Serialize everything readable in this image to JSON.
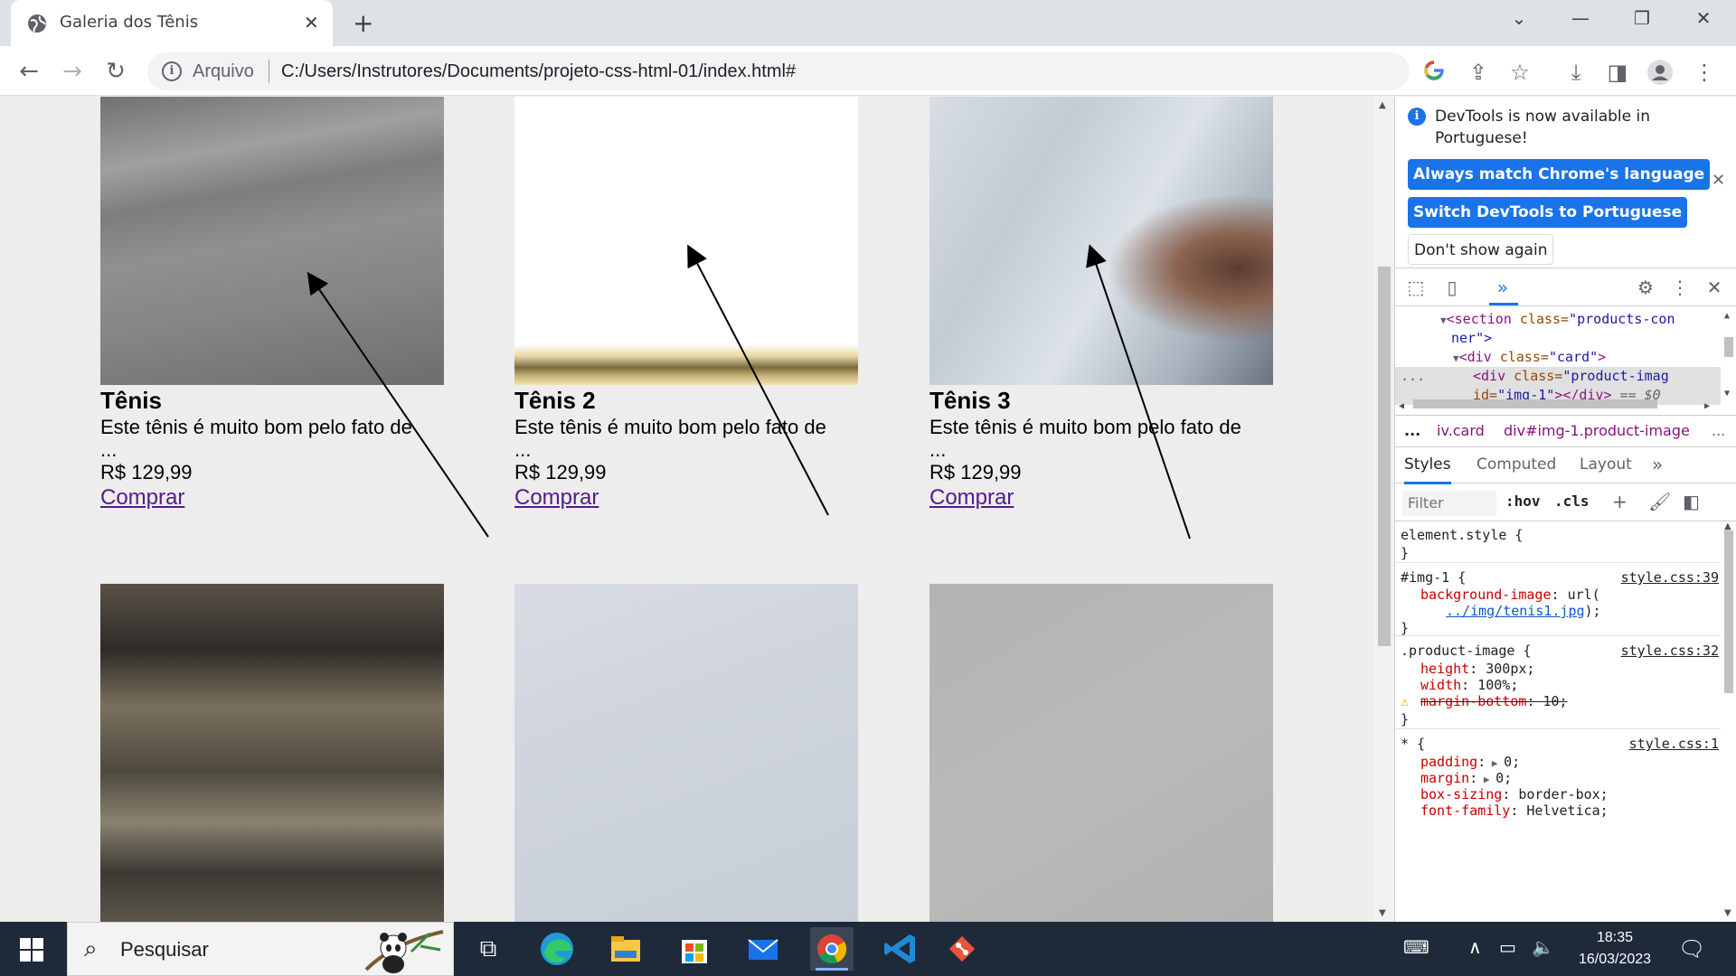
{
  "browser": {
    "tab_title": "Galeria dos Tênis",
    "omnibox_prefix": "Arquivo",
    "url": "C:/Users/Instrutores/Documents/projeto-css-html-01/index.html#"
  },
  "page": {
    "cards": [
      {
        "title": "Tênis",
        "description": "Este tênis é muito bom pelo fato de",
        "ellipsis": "...",
        "price": "R$ 129,99",
        "link": "Comprar"
      },
      {
        "title": "Tênis 2",
        "description": "Este tênis é muito bom pelo fato de",
        "ellipsis": "...",
        "price": "R$ 129,99",
        "link": "Comprar"
      },
      {
        "title": "Tênis 3",
        "description": "Este tênis é muito bom pelo fato de",
        "ellipsis": "...",
        "price": "R$ 129,99",
        "link": "Comprar"
      }
    ]
  },
  "devtools": {
    "banner": {
      "message": "DevTools is now available in Portuguese!",
      "btn_match": "Always match Chrome's language",
      "btn_switch": "Switch DevTools to Portuguese",
      "btn_dont_show": "Don't show again"
    },
    "dom": {
      "line1_tag": "<section ",
      "line1_attr": "class=",
      "line1_val": "\"products-con",
      "line2": "ner\">",
      "line3_tag": "<div ",
      "line3_attr": "class=",
      "line3_val": "\"card\"",
      "line3_end": ">",
      "line4_tag": "<div ",
      "line4_attr": "class=",
      "line4_val": "\"product-imag",
      "line5_attr": "id=",
      "line5_val": "\"img-1\"",
      "line5_end": "></div>",
      "line5_eq": " == $0",
      "gutter": "..."
    },
    "breadcrumbs": {
      "more": "...",
      "item1": "iv.card",
      "item2": "div#img-1.product-image",
      "more_right": "..."
    },
    "tabs": {
      "styles": "Styles",
      "computed": "Computed",
      "layout": "Layout",
      "more": "»"
    },
    "filter": {
      "placeholder": "Filter",
      "hov": ":hov",
      "cls": ".cls"
    },
    "styles": {
      "element_style": "element.style {",
      "close": "}",
      "rule1_selector": "#img-1 {",
      "rule1_source": "style.css:39",
      "rule1_prop": "background-image",
      "rule1_val_prefix": "url(",
      "rule1_link": "../img/tenis1.jpg",
      "rule1_val_suffix": ");",
      "rule2_selector": ".product-image {",
      "rule2_source": "style.css:32",
      "rule2_prop1": "height",
      "rule2_val1": "300px;",
      "rule2_prop2": "width",
      "rule2_val2": "100%;",
      "rule2_prop3": "margin-bottom",
      "rule2_val3": "10;",
      "rule3_selector": "* {",
      "rule3_source": "style.css:1",
      "rule3_prop1": "padding",
      "rule3_val1": "0;",
      "rule3_prop2": "margin",
      "rule3_val2": "0;",
      "rule3_prop3": "box-sizing",
      "rule3_val3": "border-box;",
      "rule3_prop4": "font-family",
      "rule3_val4": "Helvetica;"
    }
  },
  "taskbar": {
    "search_placeholder": "Pesquisar",
    "time": "18:35",
    "date": "16/03/2023"
  },
  "colors": {
    "chrome_blue": "#1a73e8",
    "link_visited": "#551a8b",
    "taskbar_bg": "#1e2a3a"
  }
}
